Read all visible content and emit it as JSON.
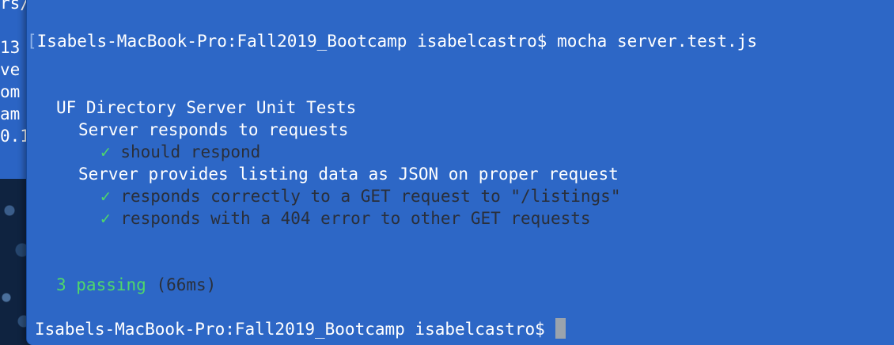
{
  "background_window": {
    "lines": [
      "rs/",
      "",
      "13",
      "ve",
      "om",
      "am",
      "0.1"
    ]
  },
  "terminal": {
    "first_prompt_bracket": "[",
    "first_prompt": "Isabels-MacBook-Pro:Fall2019_Bootcamp isabelcastro$ ",
    "first_command": "mocha server.test.js",
    "suite_title": "UF Directory Server Unit Tests",
    "groups": [
      {
        "title": "Server responds to requests",
        "tests": [
          {
            "check": "✓",
            "name": "should respond"
          }
        ]
      },
      {
        "title": "Server provides listing data as JSON on proper request",
        "tests": [
          {
            "check": "✓",
            "name": "responds correctly to a GET request to \"/listings\""
          },
          {
            "check": "✓",
            "name": "responds with a 404 error to other GET requests"
          }
        ]
      }
    ],
    "summary_passing": "3 passing",
    "summary_time": "(66ms)",
    "second_prompt": "Isabels-MacBook-Pro:Fall2019_Bootcamp isabelcastro$ "
  },
  "colors": {
    "terminal_bg": "#2d67c6",
    "text": "#ffffff",
    "check": "#4fd86a",
    "dim_text": "#2a2f3a"
  }
}
